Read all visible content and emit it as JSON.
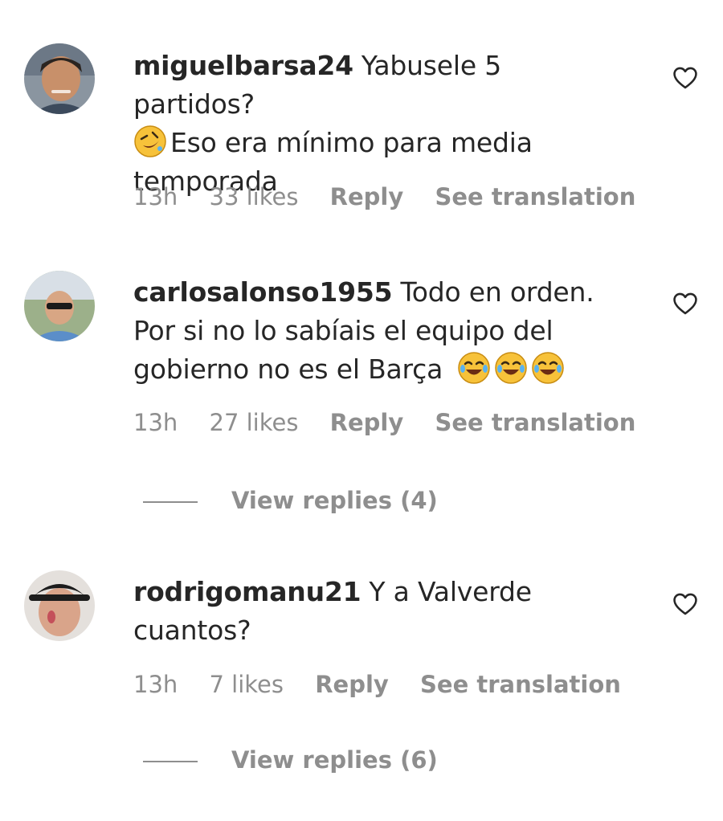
{
  "comments": [
    {
      "username": "miguelbarsa24",
      "text_line1": "Yabusele 5 partidos?",
      "text_rest": "Eso era mínimo para media temporada",
      "time": "13h",
      "likes": "33 likes",
      "reply": "Reply",
      "translate": "See translation",
      "avatar_icon": "user-avatar-photo"
    },
    {
      "username": "carlosalonso1955",
      "text": "Todo en orden. Por si no lo sabíais el equipo del gobierno no es el Barça",
      "time": "13h",
      "likes": "27 likes",
      "reply": "Reply",
      "translate": "See translation",
      "view_replies": "View replies (4)",
      "avatar_icon": "user-avatar-photo"
    },
    {
      "username": "rodrigomanu21",
      "text": "Y a Valverde cuantos?",
      "time": "13h",
      "likes": "7 likes",
      "reply": "Reply",
      "translate": "See translation",
      "view_replies": "View replies (6)",
      "avatar_icon": "user-avatar-photo"
    }
  ],
  "icons": {
    "like": "heart-outline-icon",
    "emoji_rofl": "rolling-on-floor-laughing-emoji",
    "emoji_joy": "face-with-tears-of-joy-emoji"
  },
  "colors": {
    "text": "#262626",
    "secondary": "#8e8e8e",
    "emoji_yellow": "#f7c23a"
  }
}
